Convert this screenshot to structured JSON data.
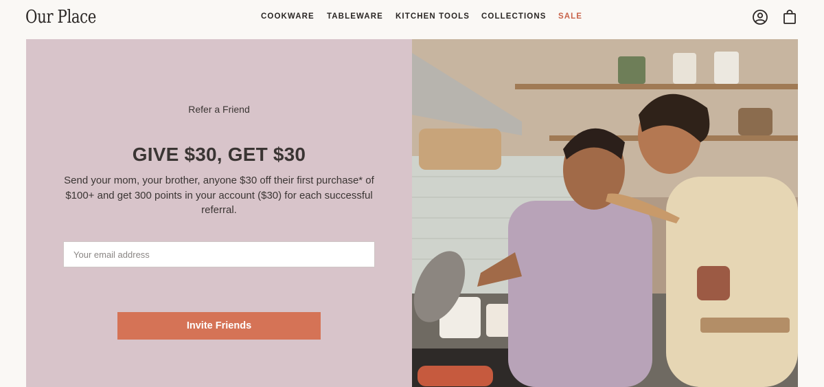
{
  "brand": {
    "logo_text": "Our Place"
  },
  "nav": {
    "items": [
      {
        "label": "COOKWARE"
      },
      {
        "label": "TABLEWARE"
      },
      {
        "label": "KITCHEN TOOLS"
      },
      {
        "label": "COLLECTIONS"
      },
      {
        "label": "SALE"
      }
    ]
  },
  "header_icons": {
    "account": "account-icon",
    "cart": "shopping-bag-icon"
  },
  "referral": {
    "eyebrow": "Refer a Friend",
    "headline": "GIVE $30, GET $30",
    "body": "Send your mom, your brother, anyone $30 off their first purchase* of $100+ and get 300 points in your account ($30) for each successful referral.",
    "email_placeholder": "Your email address",
    "email_value": "",
    "button_label": "Invite Friends"
  },
  "colors": {
    "panel_bg": "#d8c4ca",
    "button_bg": "#d57356",
    "sale_color": "#c8634a",
    "text": "#3a3533"
  }
}
